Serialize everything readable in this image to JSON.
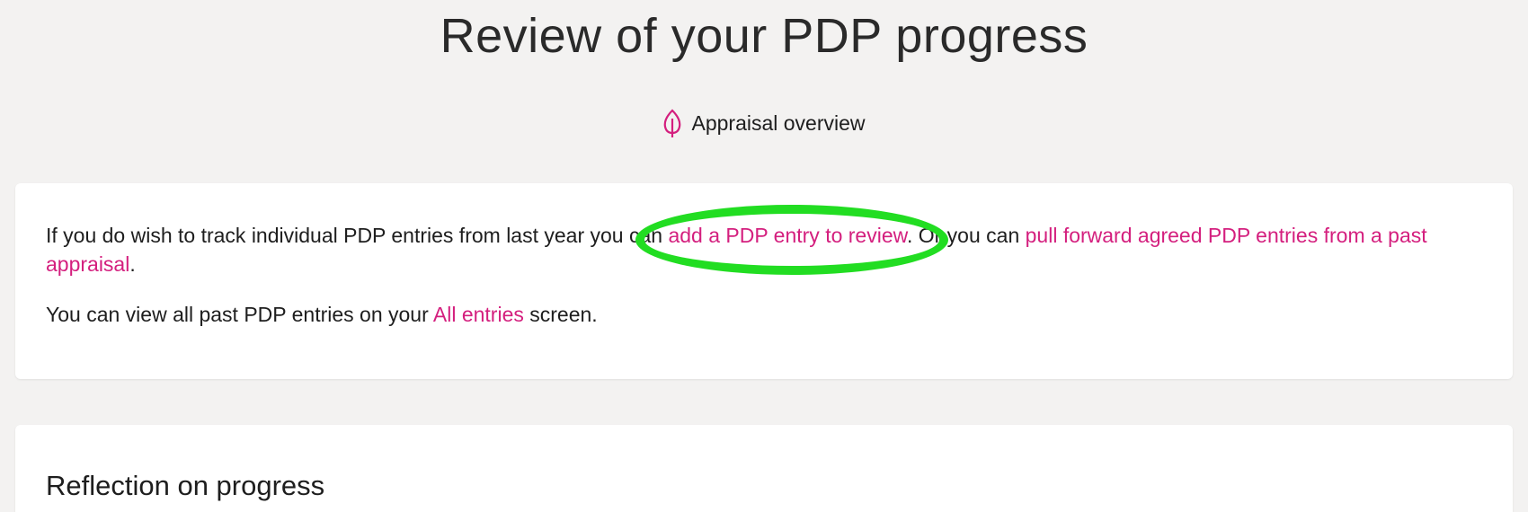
{
  "header": {
    "title": "Review of your PDP progress"
  },
  "overview": {
    "label": "Appraisal overview",
    "icon": "leaf-icon",
    "icon_color": "#d41f7e"
  },
  "intro": {
    "p1_before": "If you do wish to track individual PDP entries from last year you can ",
    "p1_link1": "add a PDP entry to review",
    "p1_middle": ". Or you can ",
    "p1_link2": "pull forward agreed PDP entries from a past appraisal",
    "p1_after": ".",
    "p2_before": "You can view all past PDP entries on your ",
    "p2_link": "All entries",
    "p2_after": " screen."
  },
  "reflection": {
    "heading": "Reflection on progress"
  },
  "colors": {
    "accent": "#d41f7e",
    "background": "#f3f2f1",
    "card": "#ffffff",
    "highlight": "#22dd22"
  }
}
